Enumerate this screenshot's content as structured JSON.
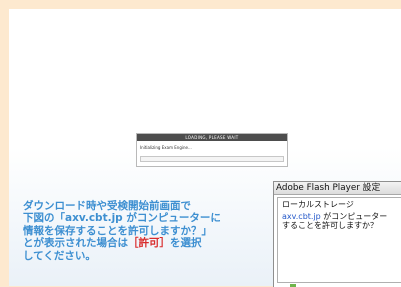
{
  "loader": {
    "title": "LOADING, PLEASE WAIT",
    "message": "Initializing Exam Engine..."
  },
  "instruction": {
    "line1": "ダウンロード時や受検開始前画面で",
    "line2_pre": "下図の「",
    "line2_domain": "axv.cbt.jp",
    "line2_post": " がコンピューターに",
    "line3": "情報を保存することを許可しますか？」",
    "line4_pre": "とが表示された場合は",
    "line4_highlight": "［許可］",
    "line4_post": "を選択",
    "line5": "してください。"
  },
  "flash_dialog": {
    "title": "Adobe Flash Player 設定",
    "heading": "ローカルストレージ",
    "link": "axv.cbt.jp",
    "line1_rest": " がコンピューター",
    "line2": "することを許可しますか？"
  }
}
